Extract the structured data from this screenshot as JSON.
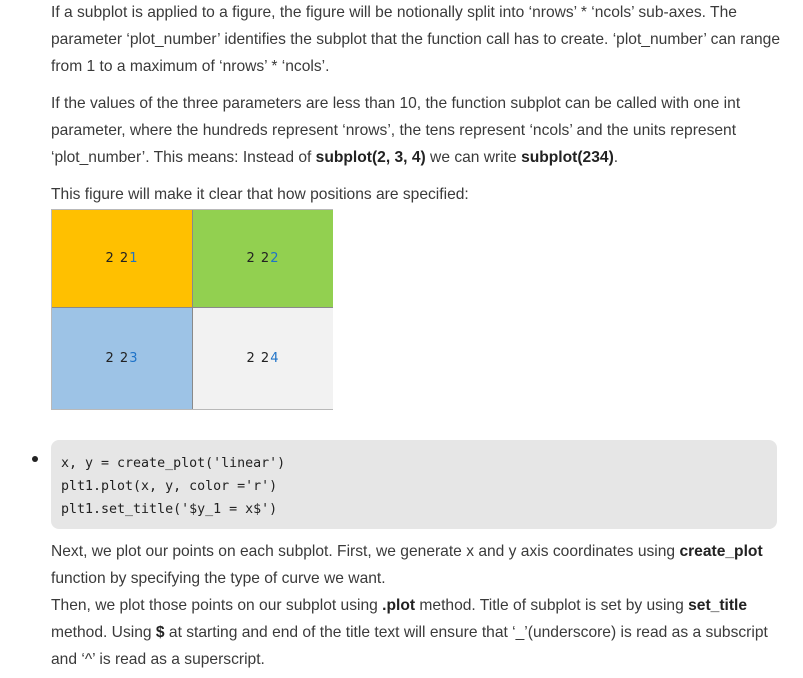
{
  "paragraph1": {
    "text": "If a subplot is applied to a figure, the figure will be notionally split into ‘nrows’ * ‘ncols’ sub-axes. The parameter ‘plot_number’ identifies the subplot that the function call has to create. ‘plot_number’ can range from 1 to a maximum of ‘nrows’ * ‘ncols’."
  },
  "paragraph2": {
    "lead": "If the values of the three parameters are less than 10, the function subplot can be called with one int parameter, where the hundreds represent ‘nrows’, the tens represent ‘ncols’ and the units represent ‘plot_number’. This means: Instead of ",
    "code1": "subplot(2, 3, 4)",
    "middle": " we can write ",
    "code2": "subplot(234)",
    "end": "."
  },
  "paragraph3": {
    "text": "This figure will make it clear that how positions are specified:"
  },
  "grid": {
    "cells": [
      {
        "prefix": "2 2 ",
        "num": "1",
        "color": "#ffc000"
      },
      {
        "prefix": "2 2 ",
        "num": "2",
        "color": "#92d050"
      },
      {
        "prefix": "2 2 ",
        "num": "3",
        "color": "#9dc3e6"
      },
      {
        "prefix": "2 2 ",
        "num": "4",
        "color": "#f2f2f2"
      }
    ]
  },
  "code_block": {
    "lines": [
      "x, y = create_plot('linear')",
      "plt1.plot(x, y, color ='r')",
      "plt1.set_title('$y_1 = x$')"
    ]
  },
  "paragraph4": {
    "s1": "Next, we plot our points on each subplot. First, we generate x and y axis coordinates using ",
    "b1": "create_plot",
    "s2": " function by specifying the type of curve we want.",
    "s3": "Then, we plot those points on our subplot using ",
    "b2": ".plot",
    "s4": " method. Title of subplot is set by using ",
    "b3": "set_title",
    "s5": " method. Using ",
    "b4": "$",
    "s6": " at starting and end of the title text will ensure that ‘_’(underscore) is read as a subscript and ‘^’ is read as a superscript."
  }
}
